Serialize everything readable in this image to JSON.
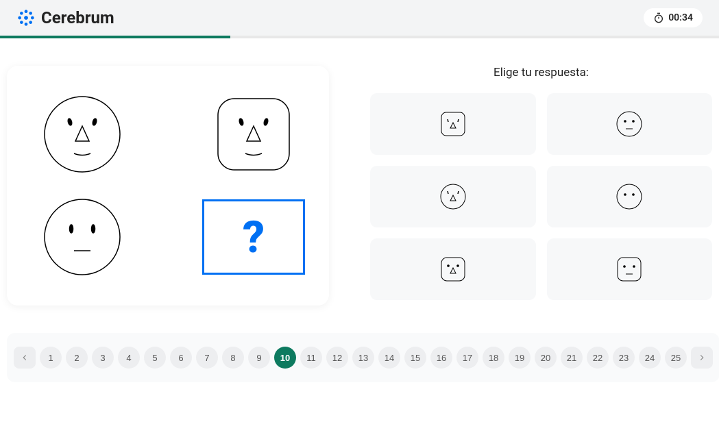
{
  "brand": "Cerebrum",
  "timer": "00:34",
  "progress_percent": 32,
  "answer_prompt": "Elige tu respuesta:",
  "question_symbol": "?",
  "current_page": 10,
  "total_pages": 25,
  "pages": [
    "1",
    "2",
    "3",
    "4",
    "5",
    "6",
    "7",
    "8",
    "9",
    "10",
    "11",
    "12",
    "13",
    "14",
    "15",
    "16",
    "17",
    "18",
    "19",
    "20",
    "21",
    "22",
    "23",
    "24",
    "25"
  ],
  "puzzle": {
    "cells": [
      {
        "shape": "circle",
        "nose": "triangle",
        "eyes": "slanted",
        "mouth": "curve"
      },
      {
        "shape": "rounded-square",
        "nose": "triangle",
        "eyes": "slanted",
        "mouth": "curve"
      },
      {
        "shape": "circle",
        "nose": "none",
        "eyes": "vertical",
        "mouth": "line"
      },
      {
        "shape": "question"
      }
    ]
  },
  "answers": [
    {
      "shape": "rounded-square-small",
      "nose": "triangle",
      "eyes": "apostrophe",
      "mouth": "none"
    },
    {
      "shape": "circle",
      "nose": "none",
      "eyes": "dot",
      "mouth": "line"
    },
    {
      "shape": "circle",
      "nose": "triangle",
      "eyes": "apostrophe",
      "mouth": "none"
    },
    {
      "shape": "circle",
      "nose": "none",
      "eyes": "dot",
      "mouth": "none"
    },
    {
      "shape": "rounded-square",
      "nose": "triangle",
      "eyes": "dot",
      "mouth": "none"
    },
    {
      "shape": "rounded-square",
      "nose": "none",
      "eyes": "dot",
      "mouth": "line"
    }
  ]
}
